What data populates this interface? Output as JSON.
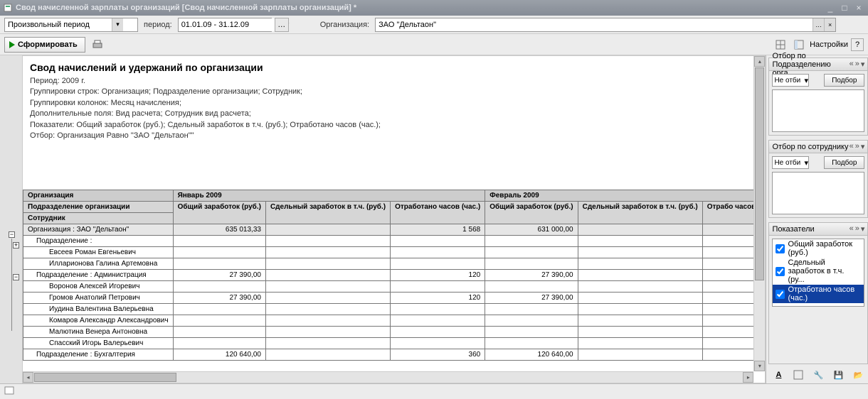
{
  "title": "Свод начисленной зарплаты организаций [Свод начисленной зарплаты организаций] *",
  "toolbar": {
    "period_mode": "Произвольный период",
    "period_label": "период:",
    "period_value": "01.01.09 - 31.12.09",
    "org_label": "Организация:",
    "org_value": "ЗАО \"Дельтаон\"",
    "form_button": "Сформировать",
    "settings_button": "Настройки"
  },
  "report": {
    "title": "Свод начислений и удержаний по организации",
    "meta": [
      "Период: 2009 г.",
      "Группировки строк: Организация; Подразделение организации; Сотрудник;",
      "Группировки колонок: Месяц начисления;",
      "Дополнительные поля: Вид расчета; Сотрудник вид расчета;",
      "Показатели: Общий заработок (руб.); Сдельный заработок в т.ч. (руб.); Отработано часов (час.);",
      "Отбор: Организация Равно \"ЗАО \"Дельтаон\"\""
    ]
  },
  "grid": {
    "row_headers": [
      "Организация",
      "Подразделение организации",
      "Сотрудник"
    ],
    "months": [
      "Январь 2009",
      "Февраль 2009"
    ],
    "measures": [
      "Общий заработок (руб.)",
      "Сдельный заработок в т.ч. (руб.)",
      "Отработано часов (час.)",
      "Общий заработок (руб.)",
      "Сдельный заработок в т.ч. (руб.)",
      "Отрабо часов ("
    ],
    "rows": [
      {
        "label": "Организация : ЗАО \"Дельтаон\"",
        "cls": "row-org",
        "vals": [
          "635 013,33",
          "",
          "1 568",
          "631 000,00",
          "",
          ""
        ]
      },
      {
        "label": "Подразделение :",
        "cls": "indent1",
        "vals": [
          "",
          "",
          "",
          "",
          "",
          ""
        ]
      },
      {
        "label": "Евсеев Роман Евгеньевич",
        "cls": "indent2",
        "vals": [
          "",
          "",
          "",
          "",
          "",
          ""
        ]
      },
      {
        "label": "Илларионова Галина Артемовна",
        "cls": "indent2",
        "vals": [
          "",
          "",
          "",
          "",
          "",
          ""
        ]
      },
      {
        "label": "Подразделение : Администрация",
        "cls": "indent1",
        "vals": [
          "27 390,00",
          "",
          "120",
          "27 390,00",
          "",
          ""
        ]
      },
      {
        "label": "Воронов Алексей Игоревич",
        "cls": "indent2",
        "vals": [
          "",
          "",
          "",
          "",
          "",
          ""
        ]
      },
      {
        "label": "Громов Анатолий Петрович",
        "cls": "indent2",
        "vals": [
          "27 390,00",
          "",
          "120",
          "27 390,00",
          "",
          ""
        ]
      },
      {
        "label": "Иудина Валентина Валерьевна",
        "cls": "indent2",
        "vals": [
          "",
          "",
          "",
          "",
          "",
          ""
        ]
      },
      {
        "label": "Комаров Александр Александрович",
        "cls": "indent2",
        "vals": [
          "",
          "",
          "",
          "",
          "",
          ""
        ]
      },
      {
        "label": "Малютина Венера Антоновна",
        "cls": "indent2",
        "vals": [
          "",
          "",
          "",
          "",
          "",
          ""
        ]
      },
      {
        "label": "Спасский Игорь Валерьевич",
        "cls": "indent2",
        "vals": [
          "",
          "",
          "",
          "",
          "",
          ""
        ]
      },
      {
        "label": "Подразделение : Бухгалтерия",
        "cls": "indent1",
        "vals": [
          "120 640,00",
          "",
          "360",
          "120 640,00",
          "",
          ""
        ]
      }
    ]
  },
  "side": {
    "panel1_title": "Отбор по Подразделению орга...",
    "panel2_title": "Отбор по сотруднику",
    "panel3_title": "Показатели",
    "filter_mode": "Не отби",
    "pick_button": "Подбор",
    "indicators": [
      {
        "label": "Общий заработок (руб.)",
        "checked": true,
        "sel": false
      },
      {
        "label": "Сдельный заработок в т.ч. (ру...",
        "checked": true,
        "sel": false
      },
      {
        "label": "Отработано часов (час.)",
        "checked": true,
        "sel": true
      }
    ]
  }
}
